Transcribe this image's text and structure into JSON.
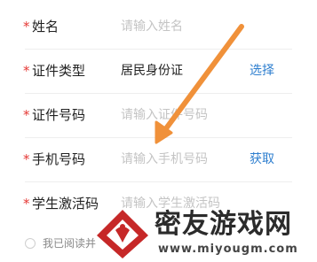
{
  "form": {
    "required_mark": "*",
    "fields": [
      {
        "label": "姓名",
        "placeholder": "请输入姓名"
      },
      {
        "label": "证件类型",
        "value": "居民身份证",
        "action": "选择"
      },
      {
        "label": "证件号码",
        "placeholder": "请输入证件号码"
      },
      {
        "label": "手机号码",
        "placeholder": "请输入手机号码",
        "action": "获取"
      },
      {
        "label": "学生激活码",
        "placeholder": "请输入学生激活码"
      }
    ],
    "agreement_text": "我已阅读并"
  },
  "watermark": {
    "title": "密友游戏网",
    "url": "www.miyougm.com"
  },
  "colors": {
    "required": "#e53935",
    "action": "#2f7fcf",
    "arrow": "#f0913a",
    "placeholder": "#c4c4c4",
    "logo": "#c62828"
  },
  "annotation": {
    "icon": "arrow-icon"
  }
}
